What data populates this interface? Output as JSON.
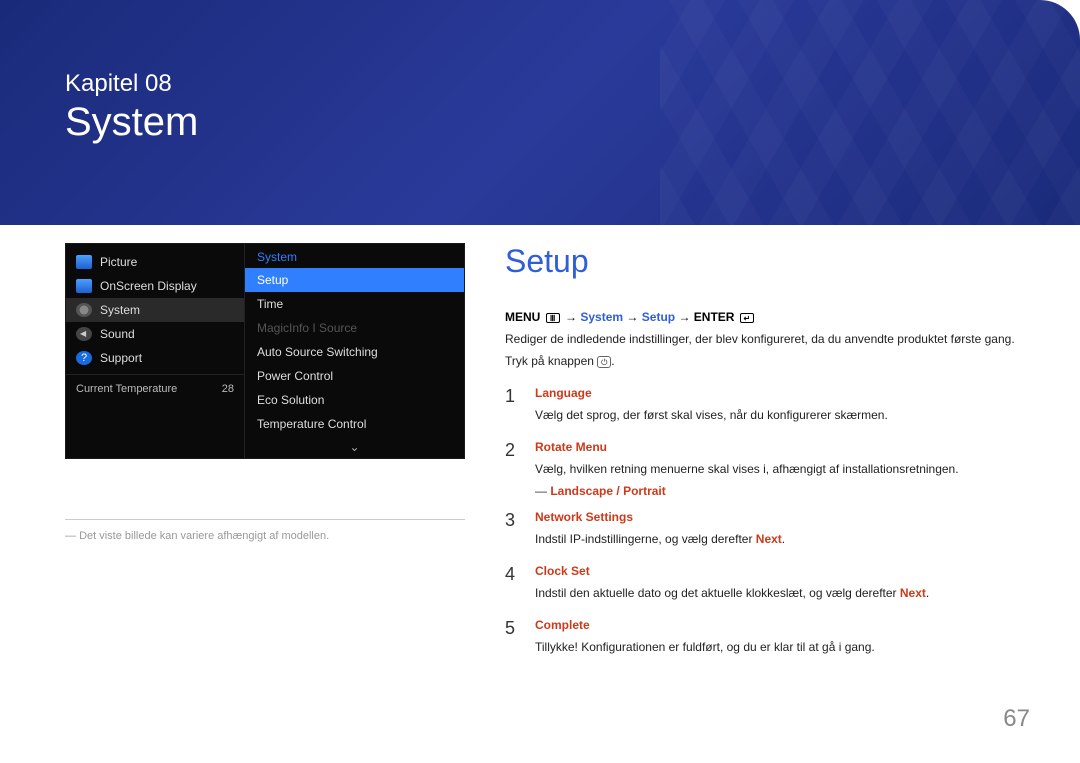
{
  "chapter": {
    "label": "Kapitel 08",
    "title": "System"
  },
  "osd": {
    "sidebar": [
      {
        "label": "Picture",
        "icon": "picture"
      },
      {
        "label": "OnScreen Display",
        "icon": "picture"
      },
      {
        "label": "System",
        "icon": "gear",
        "active": true
      },
      {
        "label": "Sound",
        "icon": "sound"
      },
      {
        "label": "Support",
        "icon": "support"
      }
    ],
    "temp": {
      "label": "Current Temperature",
      "value": "28"
    },
    "panel": {
      "title": "System",
      "items": [
        {
          "label": "Setup",
          "highlight": true
        },
        {
          "label": "Time"
        },
        {
          "label": "MagicInfo I Source",
          "disabled": true
        },
        {
          "label": "Auto Source Switching"
        },
        {
          "label": "Power Control"
        },
        {
          "label": "Eco Solution"
        },
        {
          "label": "Temperature Control"
        }
      ]
    }
  },
  "left_note": "Det viste billede kan variere afhængigt af modellen.",
  "setup": {
    "heading": "Setup",
    "breadcrumb": {
      "menu": "MENU",
      "arrow": "→",
      "system": "System",
      "setup": "Setup",
      "enter": "ENTER"
    },
    "desc": "Rediger de indledende indstillinger, der blev konfigureret, da du anvendte produktet første gang.",
    "press": {
      "prefix": "Tryk på knappen ",
      "icon": "⏻",
      "suffix": "."
    },
    "steps": [
      {
        "num": "1",
        "title": "Language",
        "body": "Vælg det sprog, der først skal vises, når du konfigurerer skærmen."
      },
      {
        "num": "2",
        "title": "Rotate Menu",
        "body": "Vælg, hvilken retning menuerne skal vises i, afhængigt af installationsretningen.",
        "sub": {
          "a": "Landscape",
          "sep": " / ",
          "b": "Portrait"
        }
      },
      {
        "num": "3",
        "title": "Network Settings",
        "body_prefix": "Indstil IP-indstillingerne, og vælg derefter ",
        "body_red": "Next",
        "body_suffix": "."
      },
      {
        "num": "4",
        "title": "Clock Set",
        "body_prefix": "Indstil den aktuelle dato og det aktuelle klokkeslæt, og vælg derefter ",
        "body_red": "Next",
        "body_suffix": "."
      },
      {
        "num": "5",
        "title": "Complete",
        "body": "Tillykke! Konfigurationen er fuldført, og du er klar til at gå i gang."
      }
    ]
  },
  "page_number": "67"
}
